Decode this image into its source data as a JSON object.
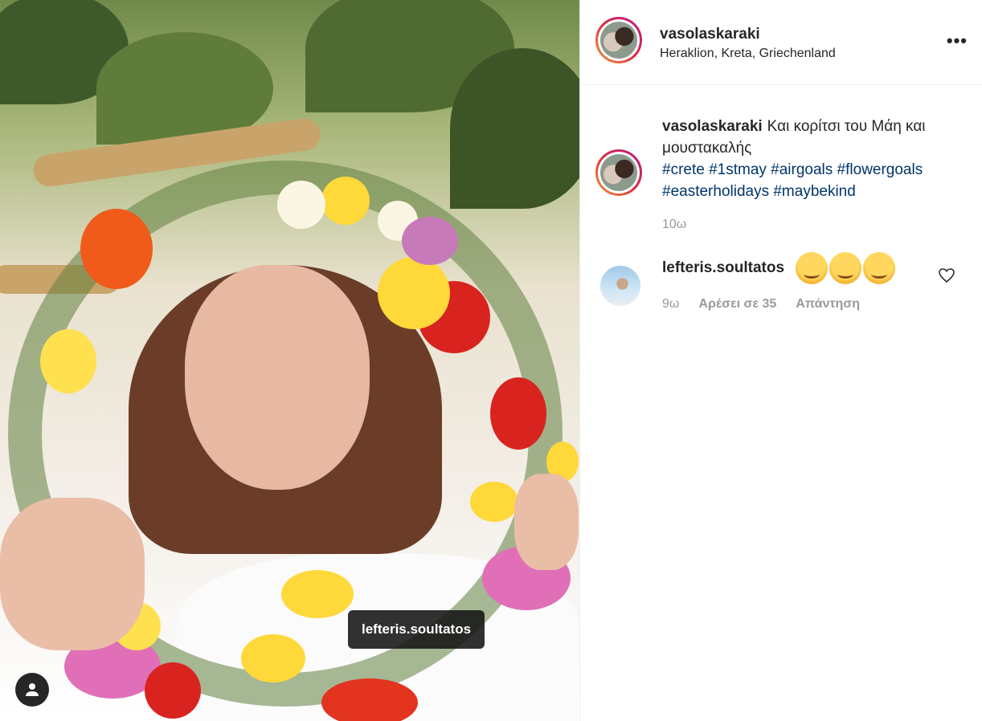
{
  "post": {
    "username": "vasolaskaraki",
    "location": "Heraklion, Kreta, Griechenland",
    "more_icon": "more-horizontal-icon",
    "caption_text": "Και κορίτσι του Μάη και μουστακαλής",
    "hashtags": "#crete #1stmay #airgoals #flowergoals #easterholidays #maybekind",
    "time": "10ω"
  },
  "photo": {
    "tag_label": "lefteris.soultatos",
    "user_tag_icon": "person-icon"
  },
  "comment": {
    "username": "lefteris.soultatos",
    "emoji_text": "🤗🤗🤗",
    "time": "9ω",
    "likes": "Αρέσει σε 35",
    "reply": "Απάντηση",
    "like_icon": "heart-icon"
  },
  "colors": {
    "hashtag": "#003569",
    "muted": "#999999",
    "text": "#262626",
    "ring_start": "#f09433",
    "ring_end": "#bc1888"
  }
}
